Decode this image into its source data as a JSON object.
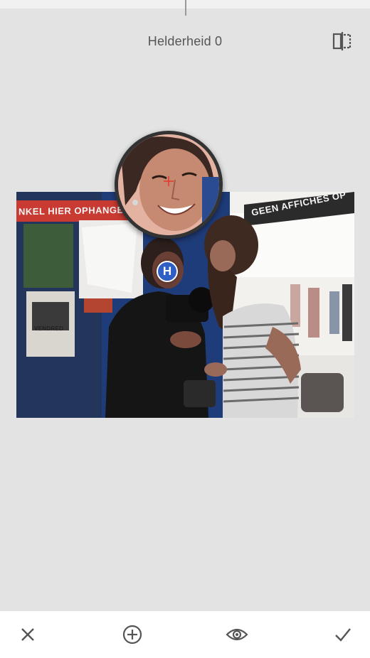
{
  "header": {
    "parameter_label": "Helderheid 0",
    "compare_icon": "compare-split-icon"
  },
  "photo": {
    "sign_left": "NKEL HIER OPHANGEN",
    "sign_right": "GEEN AFFICHES OP",
    "poster_text": "VENDRED"
  },
  "control_point": {
    "label": "H",
    "color": "#2f5ec4"
  },
  "bottom_bar": {
    "cancel_icon": "close-icon",
    "add_icon": "add-circle-icon",
    "preview_icon": "eye-icon",
    "apply_icon": "check-icon"
  },
  "colors": {
    "background": "#e3e3e3",
    "bar": "#ffffff",
    "icon": "#555555"
  }
}
